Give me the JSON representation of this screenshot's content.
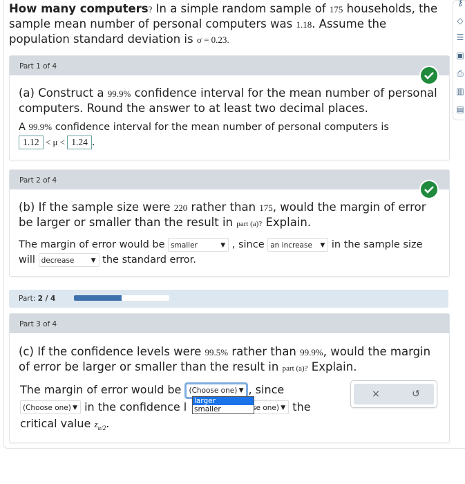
{
  "intro": {
    "bold": "How many computers",
    "q_mark": "?",
    "t1": " In a simple random sample of ",
    "n": "175",
    "t2": " households, the sample mean number of personal computers was ",
    "mean": "1.18",
    "t3": ". Assume the population standard deviation is ",
    "sigma": "σ = 0.23",
    "t4": "."
  },
  "sidebar": {
    "icons": [
      "key-icon",
      "tag-icon",
      "text-search-icon",
      "presentation-icon",
      "print-icon",
      "chart-icon",
      "document-icon"
    ]
  },
  "part1": {
    "header": "Part 1 of 4",
    "status": "correct",
    "q_a": "(a) Construct a ",
    "q_pct": "99.9%",
    "q_b": " confidence interval for the mean number of personal computers. Round the answer to at least two decimal places.",
    "ans_a": "A ",
    "ans_pct": "99.9%",
    "ans_b": " confidence interval for the mean number of personal computers is",
    "lower": "1.12",
    "mid": " < μ < ",
    "upper": "1.24",
    "end": "."
  },
  "part2": {
    "header": "Part 2 of 4",
    "status": "correct",
    "q_a": "(b) If the sample size were ",
    "n_new": "220",
    "q_b": " rather than ",
    "n_old": "175",
    "q_c": ", would the margin of error be larger or smaller than the result in ",
    "ref": "part (a)?",
    "q_d": " Explain.",
    "ans_a": "The margin of error would be ",
    "sel1": "smaller",
    "ans_b": " , since ",
    "sel2": "an increase",
    "ans_c": " in the sample size",
    "ans_d": "will ",
    "sel3": "decrease",
    "ans_e": " the standard error."
  },
  "progress": {
    "label": "Part: ",
    "value": "2 / 4",
    "fraction": 0.5
  },
  "part3": {
    "header": "Part 3 of 4",
    "q_a": "(c) If the confidence levels were ",
    "pct_new": "99.5%",
    "q_b": " rather than ",
    "pct_old": "99.9%",
    "q_c": ", would the margin of error be larger or smaller than the result in ",
    "ref": "part (a)?",
    "q_d": " Explain.",
    "ans_a": "The margin of error would be ",
    "sel1": "(Choose one)",
    "ans_b": ", since",
    "sel2": "(Choose one)",
    "ans_c": " in the confidence l",
    "sel3": "(Choose one)",
    "sel3_visible": "oose one)",
    "ans_d": " the",
    "ans_e": "critical value ",
    "z": "z",
    "z_sub": "α/2",
    "ans_f": ".",
    "dropdown_options": [
      "larger",
      "smaller"
    ],
    "dropdown_highlighted": "larger"
  },
  "actions": {
    "clear": "×",
    "undo": "↺"
  }
}
